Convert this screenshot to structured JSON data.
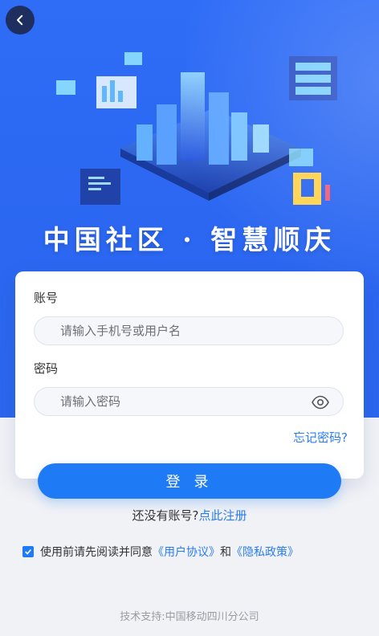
{
  "login": {
    "slogan": "中国社区 · 智慧顺庆",
    "account_label": "账号",
    "account_placeholder": "请输入手机号或用户名",
    "password_label": "密码",
    "password_placeholder": "请输入密码",
    "forgot_password": "忘记密码?",
    "login_button": "登 录",
    "no_account_text": "还没有账号?",
    "register_link": "点此注册"
  },
  "agreement": {
    "checked": true,
    "prefix": "使用前请先阅读并同意",
    "user_agreement": "《用户协议》",
    "and": "和",
    "privacy_policy": "《隐私政策》"
  },
  "footer": {
    "support_text": "技术支持:中国移动四川分公司"
  },
  "colors": {
    "primary": "#1f7bf5",
    "hero_background": "#2f6df7",
    "link": "#2a7df0"
  },
  "icons": {
    "back": "chevron-left-icon",
    "eye": "eye-icon",
    "check": "check-icon"
  }
}
